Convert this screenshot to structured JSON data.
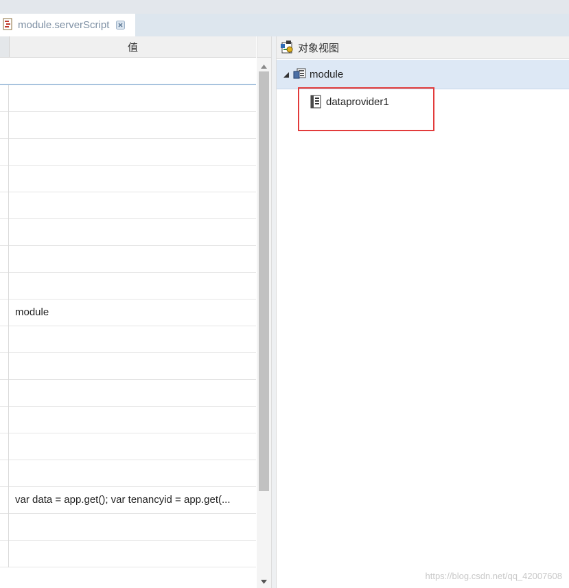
{
  "tab": {
    "label": "module.serverScript",
    "icon": "script-file-icon",
    "close_icon": "close-icon"
  },
  "grid": {
    "value_header": "值",
    "rows": [
      "",
      "",
      "",
      "",
      "",
      "",
      "",
      "",
      "module",
      "",
      "",
      "",
      "",
      "",
      "",
      "var data = app.get(); var tenancyid = app.get(...",
      "",
      ""
    ]
  },
  "object_view": {
    "title": "对象视图",
    "root": {
      "label": "module",
      "expanded": true
    },
    "children": [
      {
        "label": "dataprovider1"
      }
    ]
  },
  "watermark": "https://blog.csdn.net/qq_42007608",
  "colors": {
    "selection": "#dde8f5",
    "highlight_box": "#e23b3b",
    "tab_text": "#7d8fa3"
  }
}
